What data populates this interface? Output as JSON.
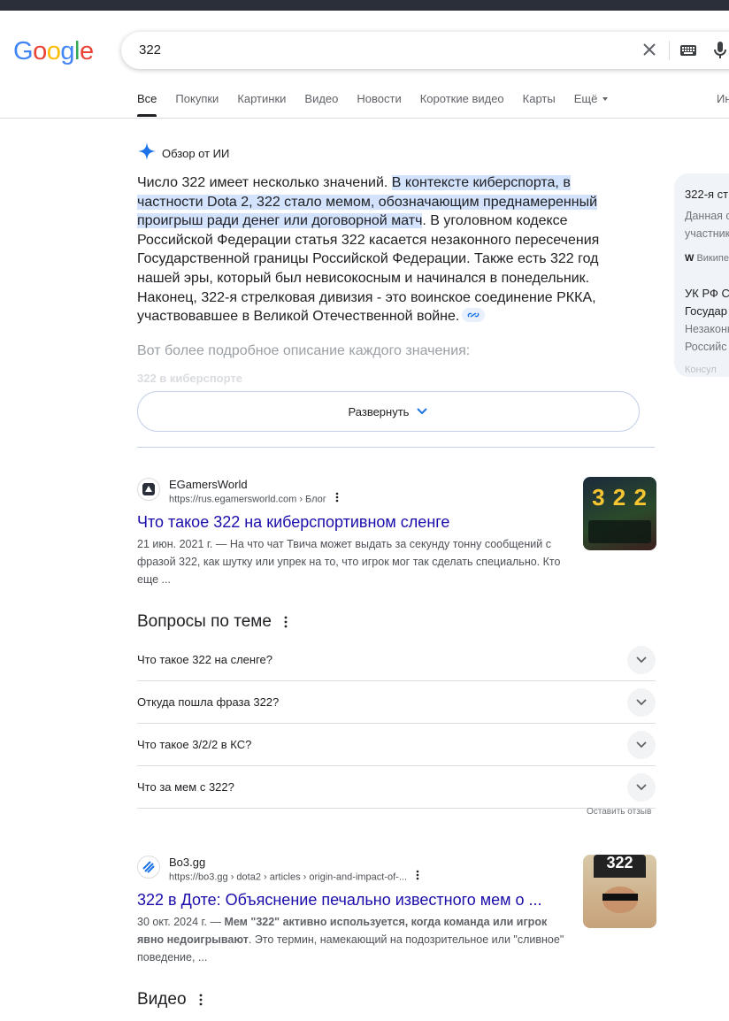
{
  "search": {
    "query": "322"
  },
  "logo": {
    "text": "Google"
  },
  "tabs": [
    {
      "label": "Все"
    },
    {
      "label": "Покупки"
    },
    {
      "label": "Картинки"
    },
    {
      "label": "Видео"
    },
    {
      "label": "Новости"
    },
    {
      "label": "Короткие видео"
    },
    {
      "label": "Карты"
    },
    {
      "label": "Ещё"
    }
  ],
  "tools_label": "Ин",
  "ai_overview": {
    "title": "Обзор от ИИ",
    "p1": "Число 322 имеет несколько значений. ",
    "p1_highlight": "В контексте киберспорта, в частности Dota 2, 322 стало мемом, обозначающим преднамеренный проигрыш ради денег или договорной матч",
    "p1_rest": ". В уголовном кодексе Российской Федерации статья 322 касается незаконного пересечения Государственной границы Российской Федерации. Также есть 322 год нашей эры, который был невисокосным и начинался в понедельник. Наконец, 322-я стрелковая дивизия - это воинское соединение РККА, участвовавшее в Великой Отечественной войне.",
    "more_text": "Вот более подробное описание каждого значения:",
    "faded_heading": "322 в киберспорте",
    "expand_label": "Развернуть"
  },
  "side_panel": {
    "card1": {
      "title": "322-я ст",
      "line1": "Данная с",
      "line2": "участник",
      "source": "Википе"
    },
    "card2": {
      "title": "УК РФ С",
      "title2": "Государ",
      "line1": "Незаконн",
      "line2": "Российс",
      "source": "Консул"
    }
  },
  "results": [
    {
      "site": "EGamersWorld",
      "url": "https://rus.egamersworld.com › Блог",
      "title": "Что такое 322 на киберспортивном сленге",
      "date": "21 июн. 2021 г.",
      "snippet": " — На что чат Твича может выдать за секунду тонну сообщений с фразой 322, как шутку или упрек на то, что игрок мог так сделать специально. Кто еще ...",
      "thumb_text": "3 2 2"
    },
    {
      "site": "Bo3.gg",
      "url": "https://bo3.gg › dota2 › articles › origin-and-impact-of-...",
      "title": "322 в Доте: Объяснение печально известного мем о ...",
      "date": "30 окт. 2024 г.",
      "snippet_bold": "Мем \"322\" активно используется, когда команда или игрок явно недоигрывают",
      "snippet": ". Это термин, намекающий на подозрительное или \"сливное\" поведение, ...",
      "thumb_text": "322"
    }
  ],
  "related_questions": {
    "title": "Вопросы по теме",
    "items": [
      {
        "q": "Что такое 322 на сленге?"
      },
      {
        "q": "Откуда пошла фраза 322?"
      },
      {
        "q": "Что такое 3/2/2 в КС?"
      },
      {
        "q": "Что за мем с 322?"
      }
    ],
    "feedback": "Оставить отзыв"
  },
  "videos": {
    "title": "Видео"
  },
  "colors": {
    "link": "#1a0dab",
    "highlight": "#d3e3fd",
    "accent": "#1a73e8"
  }
}
